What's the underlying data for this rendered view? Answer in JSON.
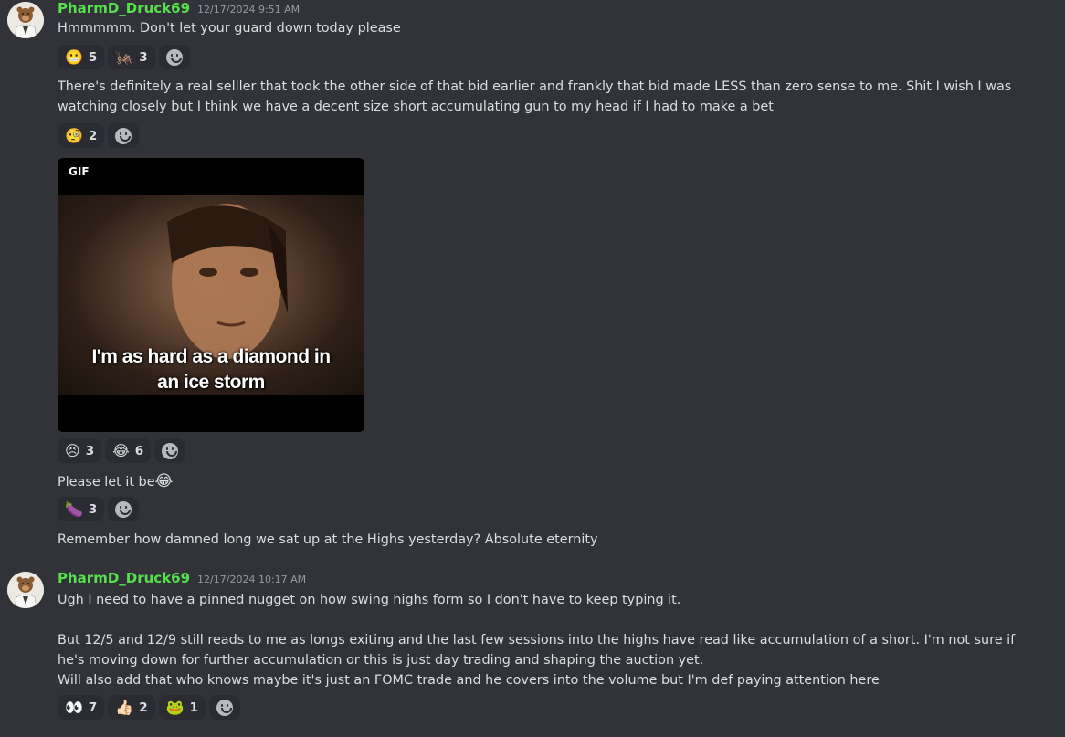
{
  "messages": [
    {
      "author": "PharmD_Druck69",
      "timestamp": "12/17/2024 9:51 AM",
      "text": "Hmmmmm. Don't let your guard down today please",
      "reactions": [
        {
          "emoji": "😬",
          "count": "5"
        },
        {
          "emoji": "🦗",
          "count": "3"
        }
      ]
    },
    {
      "text": "There's definitely a real selller that took the other side of that bid earlier and frankly that bid made LESS than zero sense to me. Shit I wish I was watching closely but I think we have a decent size short accumulating gun to my head if I had to make a bet",
      "reactions": [
        {
          "emoji": "🧐",
          "count": "2"
        }
      ]
    },
    {
      "gif_badge": "GIF",
      "gif_caption_line1": "I'm as hard as a diamond in",
      "gif_caption_line2": "an ice storm",
      "reactions": [
        {
          "emoji": "😣",
          "count": "3"
        },
        {
          "emoji": "😂",
          "count": "6"
        }
      ]
    },
    {
      "text": "Please let it be",
      "inline_emoji": "😂",
      "reactions": [
        {
          "emoji": "🍆",
          "count": "3"
        }
      ]
    },
    {
      "text": "Remember how damned long we sat up at the Highs yesterday? Absolute eternity"
    },
    {
      "author": "PharmD_Druck69",
      "timestamp": "12/17/2024 10:17 AM",
      "text": "Ugh I need to have a pinned nugget on how swing highs form so I don't have to keep typing it.",
      "text2": "But 12/5 and 12/9 still reads to me as longs exiting and the last few sessions into the highs have read like accumulation of a short. I'm not sure if he's moving down for further accumulation or this is just day trading and shaping the auction yet.",
      "text3": "Will also add that who knows maybe it's just an FOMC trade and he covers into the volume but I'm def paying attention here",
      "reactions": [
        {
          "emoji": "👀",
          "count": "7"
        },
        {
          "emoji": "👍🏻",
          "count": "2"
        },
        {
          "emoji": "🐸",
          "count": "1"
        }
      ]
    }
  ],
  "colors": {
    "background": "#323339",
    "author": "#56e04c",
    "timestamp": "#949ba4",
    "reaction_bg": "#2b2c31"
  },
  "icons": {
    "add_reaction": "add-reaction-icon",
    "avatar": "bear-avatar"
  }
}
